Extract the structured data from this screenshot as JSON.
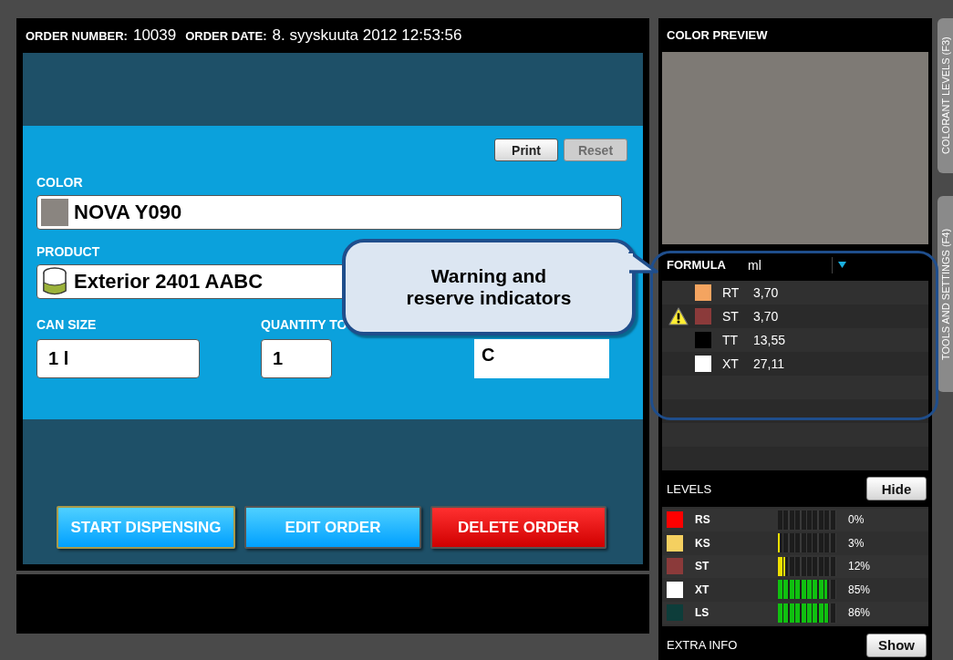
{
  "order": {
    "number_label": "ORDER NUMBER:",
    "number": "10039",
    "date_label": "ORDER DATE:",
    "date": "8. syyskuuta 2012 12:53:56"
  },
  "actions": [
    {
      "label": "Print",
      "disabled": false
    },
    {
      "label": "Reset",
      "disabled": true
    }
  ],
  "color": {
    "label": "COLOR",
    "value": "NOVA Y090"
  },
  "product": {
    "label": "PRODUCT",
    "value": "Exterior 2401 AABC"
  },
  "fields": [
    {
      "label": "CAN SIZE",
      "value": "1 l",
      "kind": "boxed"
    },
    {
      "label": "QUANTITY TO",
      "value": "1",
      "kind": "boxed"
    },
    {
      "value": "C",
      "kind": "plain"
    }
  ],
  "buttons": [
    {
      "label": "START DISPENSING",
      "kind": "primary",
      "focused": true
    },
    {
      "label": "EDIT ORDER",
      "kind": "primary",
      "focused": false
    },
    {
      "label": "DELETE ORDER",
      "kind": "danger",
      "focused": false
    }
  ],
  "preview": {
    "title": "COLOR PREVIEW"
  },
  "formula": {
    "title": "FORMULA",
    "unit": "ml",
    "rows": [
      {
        "code": "RT",
        "amount": "3,70",
        "color": "#f4a460",
        "warning": false
      },
      {
        "code": "ST",
        "amount": "3,70",
        "color": "#8b3a3a",
        "warning": true
      },
      {
        "code": "TT",
        "amount": "13,55",
        "color": "#000000",
        "warning": false
      },
      {
        "code": "XT",
        "amount": "27,11",
        "color": "#ffffff",
        "warning": false
      }
    ]
  },
  "levels": {
    "title": "LEVELS",
    "toggle": "Hide",
    "rows": [
      {
        "code": "RS",
        "color": "#ff0000",
        "level": 0,
        "reading": "0%"
      },
      {
        "code": "KS",
        "color": "#f5d060",
        "level": 0.03,
        "reading": "3%"
      },
      {
        "code": "ST",
        "color": "#8b3a3a",
        "level": 0.12,
        "reading": "12%"
      },
      {
        "code": "XT",
        "color": "#ffffff",
        "level": 0.85,
        "reading": "85%"
      },
      {
        "code": "LS",
        "color": "#0d3d3a",
        "level": 0.86,
        "reading": "86%"
      }
    ]
  },
  "extra_info": {
    "title": "EXTRA INFO",
    "toggle": "Show"
  },
  "side_tabs": [
    {
      "label": "COLORANT LEVELS (F3)"
    },
    {
      "label": "TOOLS AND SETTINGS (F4)"
    }
  ],
  "callout": {
    "text": "Warning and reserve indicators"
  }
}
